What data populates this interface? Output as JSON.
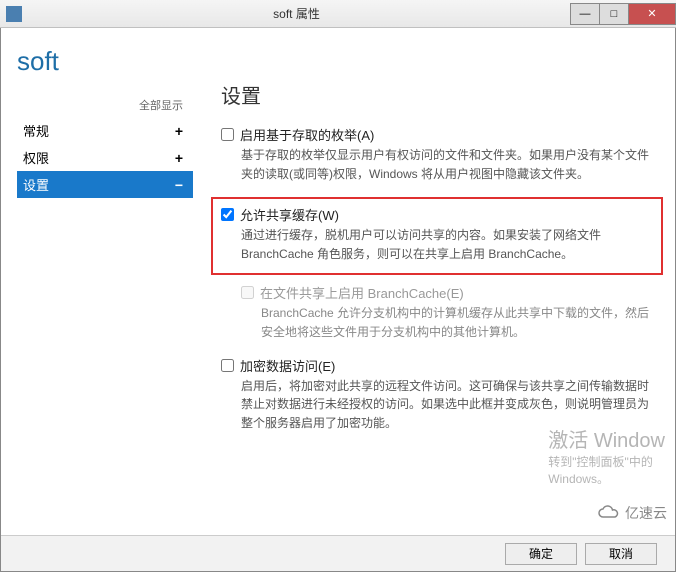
{
  "window": {
    "title": "soft 属性"
  },
  "page_title": "soft",
  "sidebar": {
    "show_all": "全部显示",
    "items": [
      {
        "label": "常规",
        "sign": "+"
      },
      {
        "label": "权限",
        "sign": "+"
      },
      {
        "label": "设置",
        "sign": "−"
      }
    ]
  },
  "panel": {
    "heading": "设置",
    "options": [
      {
        "label": "启用基于存取的枚举(A)",
        "checked": false,
        "desc": "基于存取的枚举仅显示用户有权访问的文件和文件夹。如果用户没有某个文件夹的读取(或同等)权限，Windows 将从用户视图中隐藏该文件夹。"
      },
      {
        "label": "允许共享缓存(W)",
        "checked": true,
        "desc": "通过进行缓存，脱机用户可以访问共享的内容。如果安装了网络文件 BranchCache 角色服务，则可以在共享上启用 BranchCache。"
      },
      {
        "label": "在文件共享上启用 BranchCache(E)",
        "checked": false,
        "disabled": true,
        "desc": "BranchCache 允许分支机构中的计算机缓存从此共享中下载的文件，然后安全地将这些文件用于分支机构中的其他计算机。"
      },
      {
        "label": "加密数据访问(E)",
        "checked": false,
        "desc": "启用后，将加密对此共享的远程文件访问。这可确保与该共享之间传输数据时禁止对数据进行未经授权的访问。如果选中此框并变成灰色，则说明管理员为整个服务器启用了加密功能。"
      }
    ]
  },
  "watermark": {
    "title": "激活 Window",
    "sub1": "转到\"控制面板\"中的",
    "sub2": "Windows。"
  },
  "logo": "亿速云",
  "buttons": {
    "ok": "确定",
    "cancel": "取消"
  }
}
